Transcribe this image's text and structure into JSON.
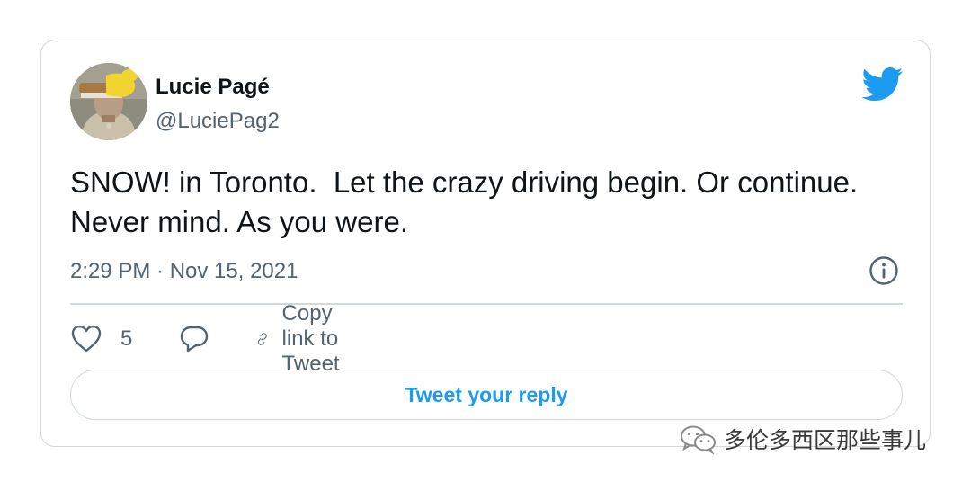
{
  "tweet": {
    "author": {
      "display_name": "Lucie Pagé",
      "handle": "@LuciePag2",
      "avatar_icon": "avatar-photo"
    },
    "brand_icon": "twitter-bird-icon",
    "text": "SNOW! in Toronto.  Let the crazy driving begin. Or continue. Never mind. As you were.",
    "timestamp": "2:29 PM · Nov 15, 2021",
    "actions": {
      "like_count": "5",
      "copy_link_label": "Copy link to Tweet"
    },
    "reply_button_label": "Tweet your reply"
  },
  "watermark": {
    "text": "多伦多西区那些事儿",
    "icon": "wechat-icon"
  },
  "colors": {
    "brand": "#1d9bf0",
    "text_primary": "#0f1419",
    "text_secondary": "#536471",
    "border": "#cfd9de"
  }
}
